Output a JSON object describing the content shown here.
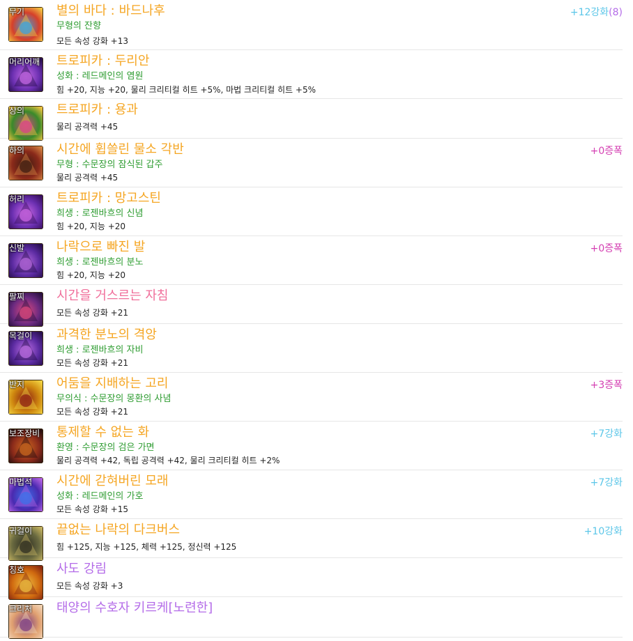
{
  "items": [
    {
      "slot": "무기",
      "name": "별의 바다 : 바드나후",
      "name_color": "#f5a623",
      "sub": "무형의 잔향",
      "stat": "모든 속성 강화 +13",
      "right": "+12강화",
      "right_extra": "(8)",
      "right_color": "#5bc6e8",
      "icon_colors": [
        "#d6402a",
        "#3aa0e0",
        "#f0c040"
      ]
    },
    {
      "slot": "머리어깨",
      "name": "트로피카 : 두리안",
      "name_color": "#f5a623",
      "sub": "성화 : 레드메인의 염원",
      "stat": "힘 +20, 지능 +20, 물리 크리티컬 히트 +5%, 마법 크리티컬 히트 +5%",
      "right": "",
      "right_extra": "",
      "right_color": "#5bc6e8",
      "icon_colors": [
        "#6a2fb0",
        "#c86ae8",
        "#2a1050"
      ]
    },
    {
      "slot": "상의",
      "name": "트로피카 : 용과",
      "name_color": "#f5a623",
      "sub": "",
      "stat": "물리 공격력 +45",
      "right": "",
      "right_extra": "",
      "right_color": "#5bc6e8",
      "icon_colors": [
        "#3a8a2a",
        "#d6408a",
        "#e8c040"
      ]
    },
    {
      "slot": "하의",
      "name": "시간에 휩쓸린 물소 각반",
      "name_color": "#f5a623",
      "sub": "무형 : 수문장의 잠식된 갑주",
      "stat": "물리 공격력 +45",
      "right": "+0증폭",
      "right_extra": "",
      "right_color": "#d43fb2",
      "icon_colors": [
        "#8a2a1a",
        "#3a1a10",
        "#d08040"
      ]
    },
    {
      "slot": "허리",
      "name": "트로피카 : 망고스틴",
      "name_color": "#f5a623",
      "sub": "희생 : 로젠바흐의 신념",
      "stat": "힘 +20, 지능 +20",
      "right": "",
      "right_extra": "",
      "right_color": "#5bc6e8",
      "icon_colors": [
        "#6a2fb0",
        "#d06ae8",
        "#3a1060"
      ]
    },
    {
      "slot": "신발",
      "name": "나락으로 빠진 발",
      "name_color": "#f5a623",
      "sub": "희생 : 로젠바흐의 분노",
      "stat": "힘 +20, 지능 +20",
      "right": "+0증폭",
      "right_extra": "",
      "right_color": "#d43fb2",
      "icon_colors": [
        "#5a2aa0",
        "#b86ae0",
        "#2a1050"
      ]
    },
    {
      "slot": "팔찌",
      "name": "시간을 거스르는 자침",
      "name_color": "#f06e9a",
      "sub": "",
      "stat": "모든 속성 강화 +21",
      "right": "",
      "right_extra": "",
      "right_color": "#5bc6e8",
      "icon_colors": [
        "#6a2a80",
        "#e04a80",
        "#2a1040"
      ]
    },
    {
      "slot": "목걸이",
      "name": "과격한 분노의 격앙",
      "name_color": "#f5a623",
      "sub": "희생 : 로젠바흐의 자비",
      "stat": "모든 속성 강화 +21",
      "right": "",
      "right_extra": "",
      "right_color": "#5bc6e8",
      "icon_colors": [
        "#5a2aa0",
        "#c070e8",
        "#2a1050"
      ]
    },
    {
      "slot": "반지",
      "name": "어둠을 지배하는 고리",
      "name_color": "#f5a623",
      "sub": "무의식 : 수문장의 몽환의 사념",
      "stat": "모든 속성 강화 +21",
      "right": "+3증폭",
      "right_extra": "",
      "right_color": "#d43fb2",
      "icon_colors": [
        "#d08a10",
        "#8a1a10",
        "#f0d040"
      ]
    },
    {
      "slot": "보조장비",
      "name": "통제할 수 없는 화",
      "name_color": "#f5a623",
      "sub": "환영 : 수문장의 검은 가면",
      "stat": "물리 공격력 +42, 독립 공격력 +42, 물리 크리티컬 히트 +2%",
      "right": "+7강화",
      "right_extra": "",
      "right_color": "#5bc6e8",
      "icon_colors": [
        "#8a2a1a",
        "#d06a20",
        "#2a1010"
      ]
    },
    {
      "slot": "마법석",
      "name": "시간에 갇혀버린 모래",
      "name_color": "#f5a623",
      "sub": "성화 : 레드메인의 가호",
      "stat": "모든 속성 강화 +15",
      "right": "+7강화",
      "right_extra": "",
      "right_color": "#5bc6e8",
      "icon_colors": [
        "#4a2ab0",
        "#3a70e8",
        "#b060e0"
      ]
    },
    {
      "slot": "귀걸이",
      "name": "끝없는 나락의 다크버스",
      "name_color": "#f5a623",
      "sub": "",
      "stat": "힘 +125, 지능 +125, 체력 +125, 정신력 +125",
      "right": "+10강화",
      "right_extra": "",
      "right_color": "#5bc6e8",
      "icon_colors": [
        "#6a6a40",
        "#2a2a20",
        "#c0b060"
      ]
    },
    {
      "slot": "칭호",
      "name": "사도 강림",
      "name_color": "#b46ce8",
      "sub": "",
      "stat": "모든 속성 강화 +3",
      "right": "",
      "right_extra": "",
      "right_color": "#5bc6e8",
      "icon_colors": [
        "#d06a10",
        "#f0c040",
        "#8a2a10"
      ]
    },
    {
      "slot": "크리처",
      "name": "태양의 수호자 키르케[노련한]",
      "name_color": "#b46ce8",
      "sub": "",
      "stat": "",
      "right": "",
      "right_extra": "",
      "right_color": "#5bc6e8",
      "icon_colors": [
        "#e0a070",
        "#7a3a80",
        "#f0d0b0"
      ]
    }
  ]
}
